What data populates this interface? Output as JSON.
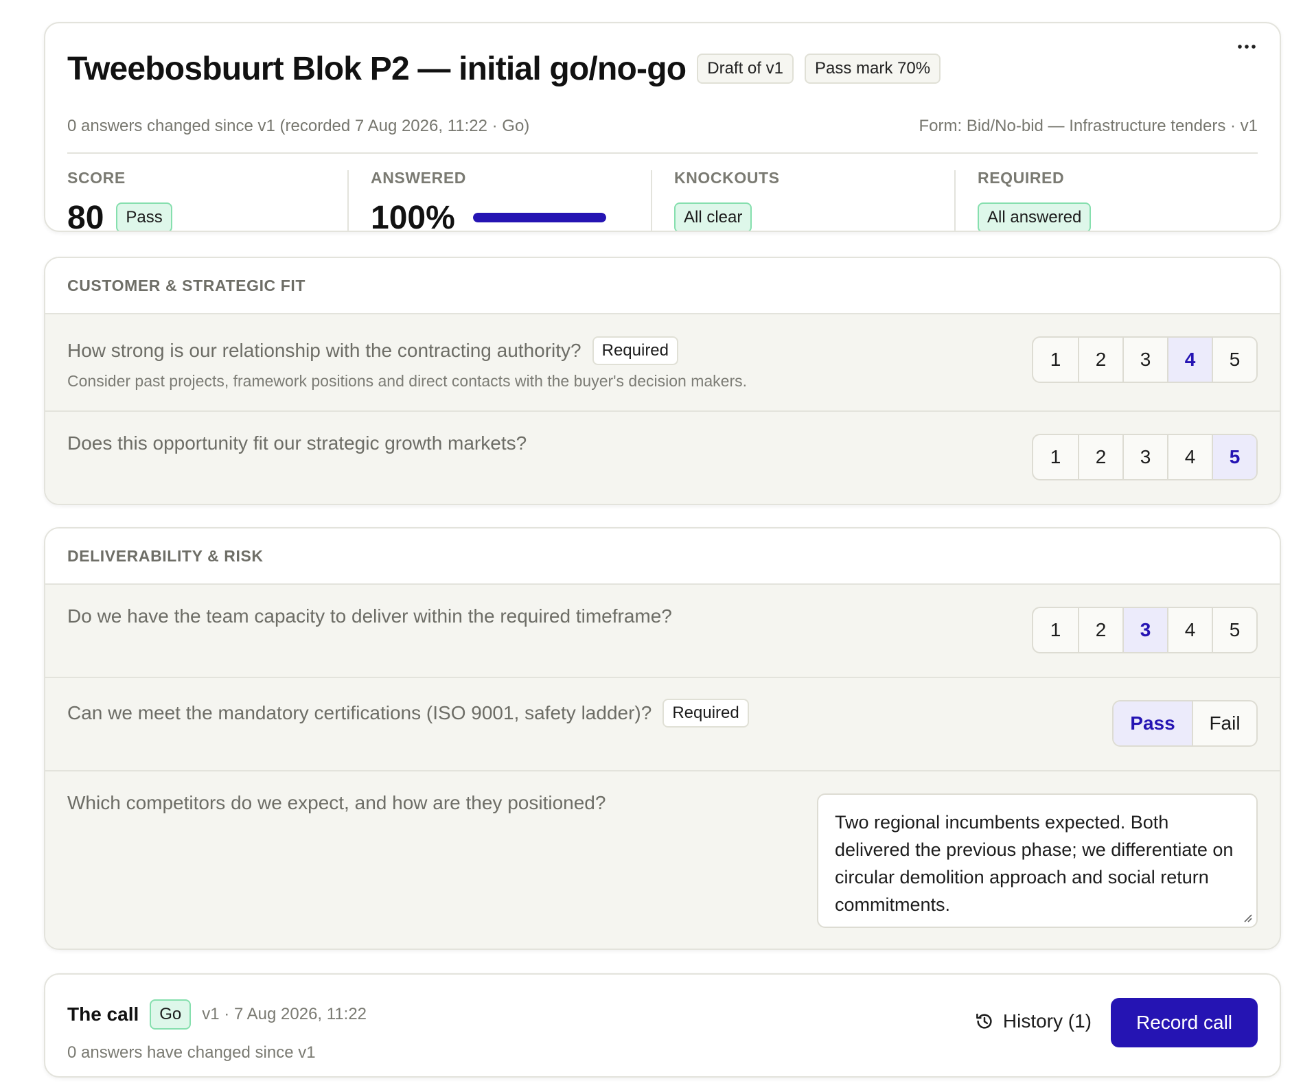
{
  "header": {
    "title": "Tweebosbuurt Blok P2 — initial go/no-go",
    "draft_badge": "Draft of v1",
    "pass_mark_badge": "Pass mark 70%",
    "more_label": "···",
    "subtitle_left": "0 answers changed since v1 (recorded 7 Aug 2026, 11:22 · Go)",
    "subtitle_right": "Form: Bid/No-bid — Infrastructure tenders · v1"
  },
  "stats": {
    "score": {
      "label": "SCORE",
      "value": "80",
      "badge": "Pass"
    },
    "answered": {
      "label": "ANSWERED",
      "value": "100%",
      "progress": 1.0
    },
    "knockouts": {
      "label": "KNOCKOUTS",
      "badge": "All clear"
    },
    "required": {
      "label": "REQUIRED",
      "badge": "All answered"
    }
  },
  "sections": [
    {
      "title": "CUSTOMER & STRATEGIC FIT",
      "questions": [
        {
          "text": "How strong is our relationship with the contracting authority?",
          "required_label": "Required",
          "help": "Consider past projects, framework positions and direct contacts with the buyer's decision makers.",
          "scale": [
            "1",
            "2",
            "3",
            "4",
            "5"
          ],
          "selected": "4"
        },
        {
          "text": "Does this opportunity fit our strategic growth markets?",
          "scale": [
            "1",
            "2",
            "3",
            "4",
            "5"
          ],
          "selected": "5"
        }
      ]
    },
    {
      "title": "DELIVERABILITY & RISK",
      "questions": [
        {
          "text": "Do we have the team capacity to deliver within the required timeframe?",
          "scale": [
            "1",
            "2",
            "3",
            "4",
            "5"
          ],
          "selected": "3"
        },
        {
          "text": "Can we meet the mandatory certifications (ISO 9001, safety ladder)?",
          "required_label": "Required",
          "options": [
            "Pass",
            "Fail"
          ],
          "selected": "Pass"
        },
        {
          "text": "Which competitors do we expect, and how are they positioned?",
          "answer": "Two regional incumbents expected. Both delivered the previous phase; we differentiate on circular demolition approach and social return commitments."
        }
      ]
    }
  ],
  "footer": {
    "title": "The call",
    "decision_badge": "Go",
    "meta": "v1 · 7 Aug 2026, 11:22",
    "subtitle": "0 answers have changed since v1",
    "history_label": "History (1)",
    "history_icon": "history-icon",
    "record_label": "Record call"
  },
  "colors": {
    "accent": "#2514b3",
    "selected_bg": "#ecebfb",
    "success_bg": "#def7ea",
    "success_border": "#86dfae"
  }
}
